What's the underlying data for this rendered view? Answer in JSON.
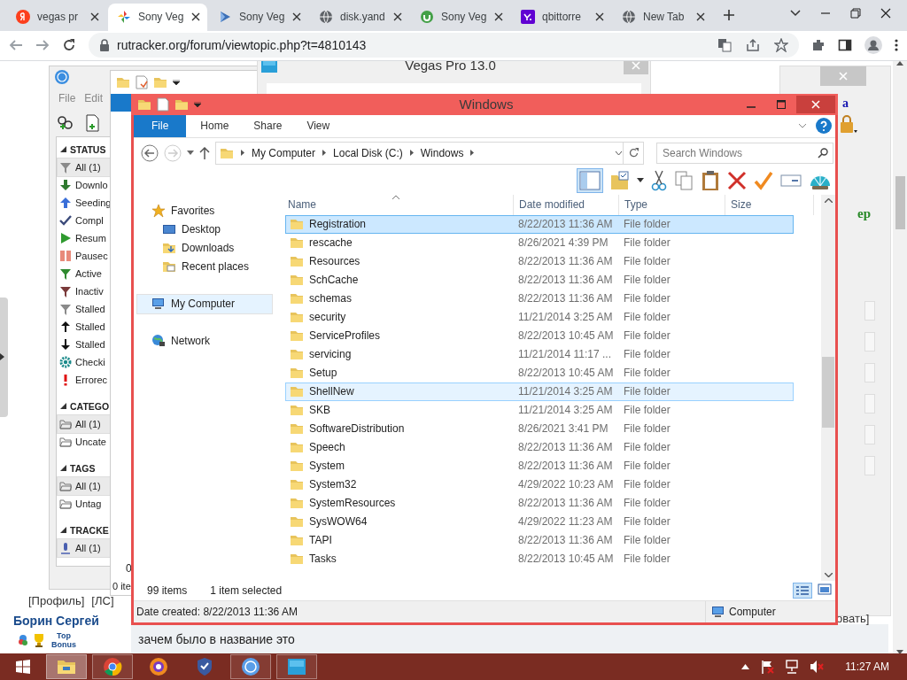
{
  "browser": {
    "tabs": [
      {
        "title": "vegas pr",
        "kind": "yandex",
        "selected": false
      },
      {
        "title": "Sony Veg",
        "kind": "pinwheel",
        "selected": true
      },
      {
        "title": "Sony Veg",
        "kind": "video",
        "selected": false
      },
      {
        "title": "disk.yand",
        "kind": "globe",
        "selected": false
      },
      {
        "title": "Sony Veg",
        "kind": "torrent",
        "selected": false
      },
      {
        "title": "qbittorre",
        "kind": "yahoo",
        "selected": false
      },
      {
        "title": "New Tab",
        "kind": "globe",
        "selected": false
      }
    ],
    "address": "rutracker.org/forum/viewtopic.php?t=4810143"
  },
  "web_page": {
    "links": [
      "[Профиль]",
      "[ЛС]"
    ],
    "user_name": "Борин Сергей",
    "badge": "Top Bonus",
    "post_text": "зачем было в название это",
    "fragments": [
      "a",
      "ep",
      "овать]"
    ]
  },
  "qbittorrent": {
    "menu": [
      "File",
      "Edit"
    ],
    "sections": [
      {
        "title": "STATUS",
        "items": [
          {
            "label": "All (1)",
            "kind": "filter",
            "selected": true
          },
          {
            "label": "Downlo",
            "kind": "down",
            "selected": false
          },
          {
            "label": "Seeding",
            "kind": "up",
            "selected": false
          },
          {
            "label": "Compl",
            "kind": "check",
            "selected": false
          },
          {
            "label": "Resum",
            "kind": "play",
            "selected": false
          },
          {
            "label": "Pausec",
            "kind": "pause",
            "selected": false
          },
          {
            "label": "Active",
            "kind": "filteron",
            "selected": false
          },
          {
            "label": "Inactiv",
            "kind": "filteroff",
            "selected": false
          },
          {
            "label": "Stalled",
            "kind": "filter",
            "selected": false
          },
          {
            "label": "Stalled",
            "kind": "upblack",
            "selected": false
          },
          {
            "label": "Stalled",
            "kind": "downblack",
            "selected": false
          },
          {
            "label": "Checki",
            "kind": "gear",
            "selected": false
          },
          {
            "label": "Errorec",
            "kind": "error",
            "selected": false
          }
        ]
      },
      {
        "title": "CATEGO",
        "items": [
          {
            "label": "All (1)",
            "kind": "folder",
            "selected": true
          },
          {
            "label": "Uncate",
            "kind": "folder",
            "selected": false
          }
        ]
      },
      {
        "title": "TAGS",
        "items": [
          {
            "label": "All (1)",
            "kind": "folder",
            "selected": true
          },
          {
            "label": "Untag",
            "kind": "folder",
            "selected": false
          }
        ]
      },
      {
        "title": "TRACKE",
        "items": [
          {
            "label": "All (1)",
            "kind": "tracker",
            "selected": true
          }
        ]
      }
    ]
  },
  "back_window": {
    "count": "0",
    "status": "0 ite"
  },
  "vegas": {
    "title": "Vegas Pro 13.0"
  },
  "explorer": {
    "title": "Windows",
    "ribbon_tabs": [
      {
        "label": "File",
        "kind": "file"
      },
      {
        "label": "Home",
        "kind": "tab"
      },
      {
        "label": "Share",
        "kind": "tab"
      },
      {
        "label": "View",
        "kind": "tab"
      }
    ],
    "path": [
      "My Computer",
      "Local Disk (C:)",
      "Windows"
    ],
    "search": {
      "placeholder": "Search Windows"
    },
    "navigation": [
      {
        "label": "Favorites",
        "kind": "star",
        "selected": false,
        "children": [
          {
            "label": "Desktop",
            "kind": "desktop",
            "selected": false
          },
          {
            "label": "Downloads",
            "kind": "downloads",
            "selected": false
          },
          {
            "label": "Recent places",
            "kind": "recent",
            "selected": false
          }
        ]
      },
      {
        "label": "My Computer",
        "kind": "computer",
        "selected": true
      },
      {
        "label": "Network",
        "kind": "network",
        "selected": false
      }
    ],
    "columns": [
      "Name",
      "Date modified",
      "Type",
      "Size"
    ],
    "rows": [
      {
        "name": "Registration",
        "date": "8/22/2013 11:36 AM",
        "type": "File folder",
        "selected": true,
        "hovered": false
      },
      {
        "name": "rescache",
        "date": "8/26/2021 4:39 PM",
        "type": "File folder",
        "selected": false,
        "hovered": false
      },
      {
        "name": "Resources",
        "date": "8/22/2013 11:36 AM",
        "type": "File folder",
        "selected": false,
        "hovered": false
      },
      {
        "name": "SchCache",
        "date": "8/22/2013 11:36 AM",
        "type": "File folder",
        "selected": false,
        "hovered": false
      },
      {
        "name": "schemas",
        "date": "8/22/2013 11:36 AM",
        "type": "File folder",
        "selected": false,
        "hovered": false
      },
      {
        "name": "security",
        "date": "11/21/2014 3:25 AM",
        "type": "File folder",
        "selected": false,
        "hovered": false
      },
      {
        "name": "ServiceProfiles",
        "date": "8/22/2013 10:45 AM",
        "type": "File folder",
        "selected": false,
        "hovered": false
      },
      {
        "name": "servicing",
        "date": "11/21/2014 11:17 ...",
        "type": "File folder",
        "selected": false,
        "hovered": false
      },
      {
        "name": "Setup",
        "date": "8/22/2013 10:45 AM",
        "type": "File folder",
        "selected": false,
        "hovered": false
      },
      {
        "name": "ShellNew",
        "date": "11/21/2014 3:25 AM",
        "type": "File folder",
        "selected": false,
        "hovered": true
      },
      {
        "name": "SKB",
        "date": "11/21/2014 3:25 AM",
        "type": "File folder",
        "selected": false,
        "hovered": false
      },
      {
        "name": "SoftwareDistribution",
        "date": "8/26/2021 3:41 PM",
        "type": "File folder",
        "selected": false,
        "hovered": false
      },
      {
        "name": "Speech",
        "date": "8/22/2013 11:36 AM",
        "type": "File folder",
        "selected": false,
        "hovered": false
      },
      {
        "name": "System",
        "date": "8/22/2013 11:36 AM",
        "type": "File folder",
        "selected": false,
        "hovered": false
      },
      {
        "name": "System32",
        "date": "4/29/2022 10:23 AM",
        "type": "File folder",
        "selected": false,
        "hovered": false
      },
      {
        "name": "SystemResources",
        "date": "8/22/2013 11:36 AM",
        "type": "File folder",
        "selected": false,
        "hovered": false
      },
      {
        "name": "SysWOW64",
        "date": "4/29/2022 11:23 AM",
        "type": "File folder",
        "selected": false,
        "hovered": false
      },
      {
        "name": "TAPI",
        "date": "8/22/2013 11:36 AM",
        "type": "File folder",
        "selected": false,
        "hovered": false
      },
      {
        "name": "Tasks",
        "date": "8/22/2013 10:45 AM",
        "type": "File folder",
        "selected": false,
        "hovered": false
      }
    ],
    "status": {
      "item_count": "99 items",
      "selection": "1 item selected"
    },
    "details": {
      "info": "Date created: 8/22/2013 11:36 AM",
      "location": "Computer"
    }
  },
  "taskbar": {
    "apps": [
      {
        "kind": "explorer",
        "running": true,
        "active": true
      },
      {
        "kind": "chrome",
        "running": true,
        "active": false
      },
      {
        "kind": "browser",
        "running": false,
        "active": false
      },
      {
        "kind": "shield",
        "running": false,
        "active": false
      },
      {
        "kind": "qbittorrent",
        "running": true,
        "active": false
      },
      {
        "kind": "vegas",
        "running": true,
        "active": false
      }
    ],
    "clock": "11:27 AM"
  }
}
